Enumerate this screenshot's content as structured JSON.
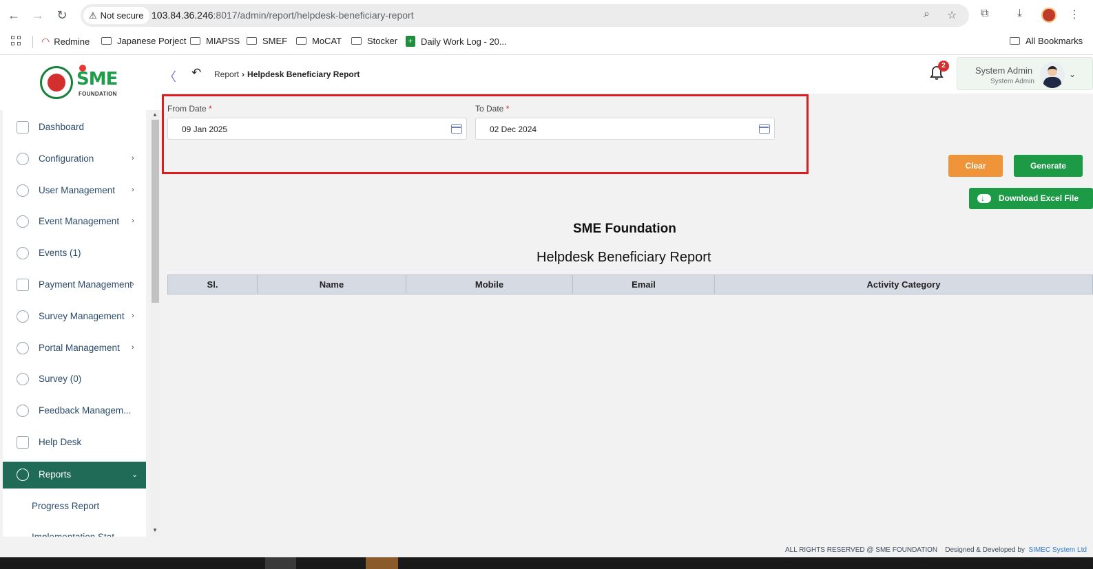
{
  "browser": {
    "security_label": "Not secure",
    "url_host": "103.84.36.246",
    "url_rest": ":8017/admin/report/helpdesk-beneficiary-report",
    "bookmarks": [
      "Redmine",
      "Japanese Porject",
      "MIAPSS",
      "SMEF",
      "MoCAT",
      "Stocker",
      "Daily Work Log - 20..."
    ],
    "all_bookmarks": "All Bookmarks"
  },
  "header": {
    "logo_text": "SME",
    "logo_sub": "FOUNDATION",
    "breadcrumb_parent": "Report",
    "breadcrumb_current": "Helpdesk Beneficiary Report",
    "notification_count": "2",
    "user_name": "System Admin",
    "user_role": "System Admin"
  },
  "sidebar": {
    "items": [
      {
        "label": "Dashboard",
        "chevron": ""
      },
      {
        "label": "Configuration",
        "chevron": "›"
      },
      {
        "label": "User Management",
        "chevron": "›"
      },
      {
        "label": "Event Management",
        "chevron": "›"
      },
      {
        "label": "Events (1)",
        "chevron": ""
      },
      {
        "label": "Payment Management",
        "chevron": "›"
      },
      {
        "label": "Survey Management",
        "chevron": "›"
      },
      {
        "label": "Portal Management",
        "chevron": "›"
      },
      {
        "label": "Survey (0)",
        "chevron": ""
      },
      {
        "label": "Feedback Managem...",
        "chevron": ""
      },
      {
        "label": "Help Desk",
        "chevron": ""
      },
      {
        "label": "Reports",
        "chevron": "⌄"
      }
    ],
    "sub_items": [
      "Progress Report",
      "Implementation Stat..."
    ]
  },
  "filters": {
    "from_label": "From Date",
    "from_value": "09 Jan 2025",
    "to_label": "To Date",
    "to_value": "02 Dec 2024",
    "required_mark": "*"
  },
  "actions": {
    "clear": "Clear",
    "generate": "Generate",
    "download_excel": "Download Excel File"
  },
  "report": {
    "org": "SME Foundation",
    "title": "Helpdesk Beneficiary Report",
    "columns": [
      "Sl.",
      "Name",
      "Mobile",
      "Email",
      "Activity Category"
    ]
  },
  "footer": {
    "rights": "ALL RIGHTS RESERVED @ SME FOUNDATION",
    "designed": "Designed & Developed by",
    "company": "SIMEC System Ltd"
  },
  "colors": {
    "sidebar_active": "#1f6b57",
    "highlight_border": "#e01b1b",
    "clear_button": "#f0943a",
    "generate_button": "#1d9a45"
  }
}
